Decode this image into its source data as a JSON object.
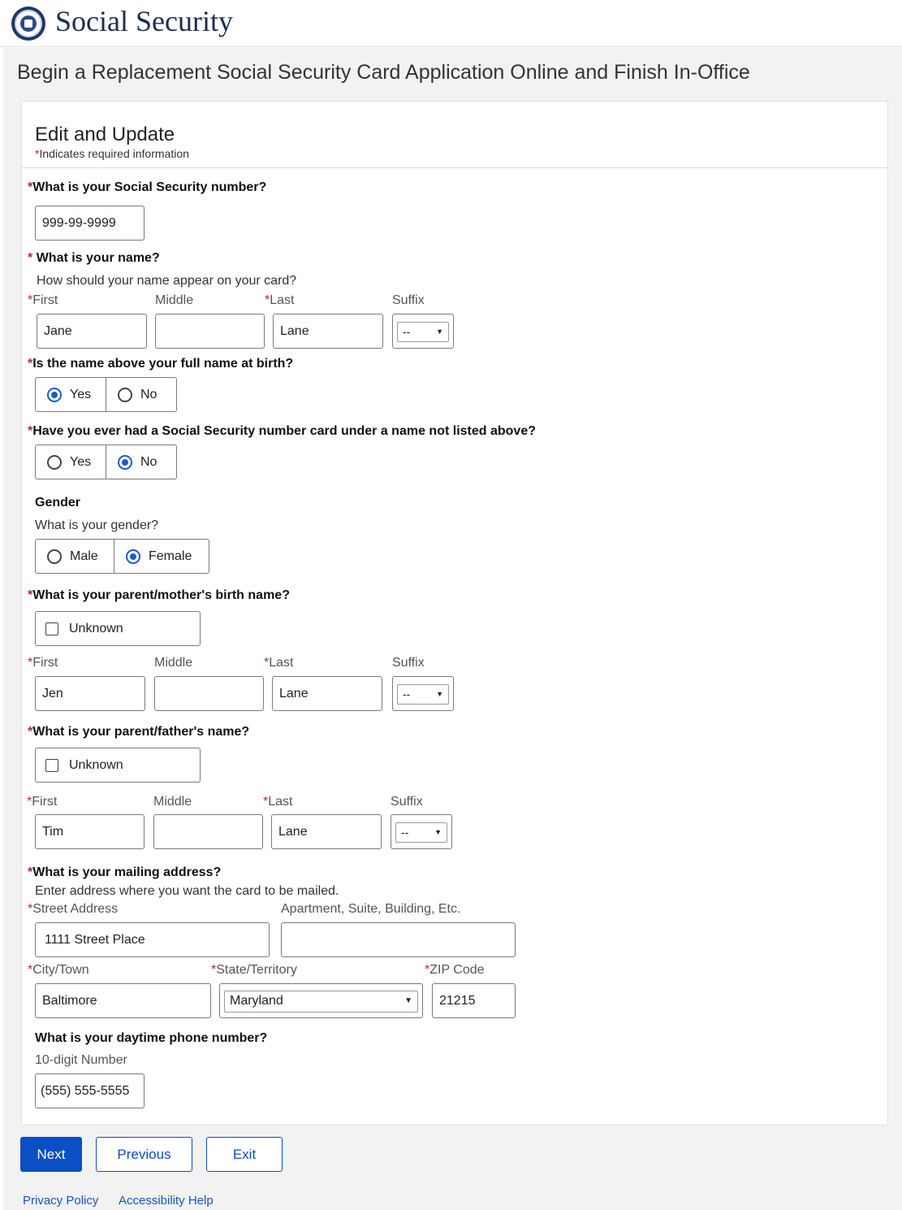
{
  "header": {
    "brand": "Social Security",
    "logo_icon": "ssa-seal-icon"
  },
  "page": {
    "title": "Begin a Replacement Social Security Card Application Online and Finish In-Office"
  },
  "card": {
    "title": "Edit and Update",
    "required_note": "Indicates required information",
    "required_mark": "*"
  },
  "ssn": {
    "question": "What is your Social Security number?",
    "value": "999-99-9999"
  },
  "name": {
    "question": "What is your name?",
    "hint": "How should your name appear on your card?",
    "labels": {
      "first": "First",
      "middle": "Middle",
      "last": "Last",
      "suffix": "Suffix"
    },
    "first": "Jane",
    "middle": "",
    "last": "Lane",
    "suffix": "--"
  },
  "full_name_at_birth": {
    "question": "Is the name above your full name at birth?",
    "options": [
      "Yes",
      "No"
    ],
    "selected": "Yes"
  },
  "other_name": {
    "question": "Have you ever had a Social Security number card under a name not listed above?",
    "options": [
      "Yes",
      "No"
    ],
    "selected": "No"
  },
  "gender": {
    "heading": "Gender",
    "question": "What is your gender?",
    "options": [
      "Male",
      "Female"
    ],
    "selected": "Female"
  },
  "mother": {
    "question": "What is your parent/mother's birth name?",
    "unknown_label": "Unknown",
    "labels": {
      "first": "First",
      "middle": "Middle",
      "last": "Last",
      "suffix": "Suffix"
    },
    "first": "Jen",
    "middle": "",
    "last": "Lane",
    "suffix": "--"
  },
  "father": {
    "question": "What is your parent/father's name?",
    "unknown_label": "Unknown",
    "labels": {
      "first": "First",
      "middle": "Middle",
      "last": "Last",
      "suffix": "Suffix"
    },
    "first": "Tim",
    "middle": "",
    "last": "Lane",
    "suffix": "--"
  },
  "address": {
    "question": "What is your mailing address?",
    "hint": "Enter address where you want the card to be mailed.",
    "labels": {
      "street": "Street Address",
      "apt": "Apartment, Suite, Building, Etc.",
      "city": "City/Town",
      "state": "State/Territory",
      "zip": "ZIP Code"
    },
    "street": "1111 Street Place",
    "apt": "",
    "city": "Baltimore",
    "state": "Maryland",
    "zip": "21215"
  },
  "phone": {
    "question": "What is your daytime phone number?",
    "label": "10-digit Number",
    "value": "(555) 555-5555"
  },
  "buttons": {
    "next": "Next",
    "previous": "Previous",
    "exit": "Exit"
  },
  "footer": {
    "privacy": "Privacy Policy",
    "accessibility": "Accessibility Help"
  },
  "colors": {
    "brand_navy": "#1d2d50",
    "primary": "#0a4fc4",
    "required": "#c0272d",
    "page_bg": "#f2f2f2"
  }
}
